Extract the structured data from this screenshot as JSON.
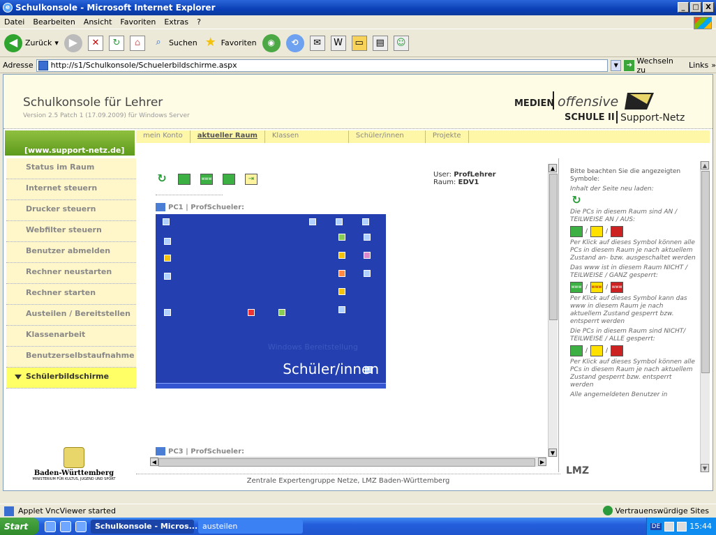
{
  "window": {
    "title": "Schulkonsole - Microsoft Internet Explorer",
    "min": "_",
    "max": "□",
    "close": "X"
  },
  "menu": [
    "Datei",
    "Bearbeiten",
    "Ansicht",
    "Favoriten",
    "Extras",
    "?"
  ],
  "toolbar": {
    "back": "Zurück",
    "search": "Suchen",
    "favorites": "Favoriten"
  },
  "address": {
    "label": "Adresse",
    "url": "http://s1/Schulkonsole/Schuelerbildschirme.aspx",
    "go": "Wechseln zu",
    "links": "Links"
  },
  "header": {
    "title": "Schulkonsole für Lehrer",
    "version": "Version 2.5 Patch 1 (17.09.2009) für Windows Server",
    "logo1": "MEDIEN",
    "logo2": "offensive",
    "logo3": "SCHULE II",
    "logo4": "Support-Netz"
  },
  "brand": "[www.support-netz.de]",
  "tabs": [
    "mein Konto",
    "aktueller Raum",
    "Klassen",
    "Schüler/innen",
    "Projekte"
  ],
  "sidebar": [
    "Status im Raum",
    "Internet steuern",
    "Drucker steuern",
    "Webfilter steuern",
    "Benutzer abmelden",
    "Rechner neustarten",
    "Rechner starten",
    "Austeilen / Bereitstellen",
    "Klassenarbeit",
    "Benutzerselbstaufnahme",
    "Schülerbildschirme"
  ],
  "user": {
    "user_label": "User:",
    "user": "ProfLehrer",
    "room_label": "Raum:",
    "room": "EDV1"
  },
  "pcs": [
    {
      "label": "PC1 | ProfSchueler:"
    },
    {
      "label": "PC3 | ProfSchueler:"
    }
  ],
  "screen": {
    "watermark": "Schüler/innen",
    "watermark2": "Windows Bereitstellung"
  },
  "right": {
    "p1": "Bitte beachten Sie die angezeigten Symbole:",
    "p2": "Inhalt der Seite neu laden:",
    "p3": "Die PCs in diesem Raum sind AN / TEILWEISE AN / AUS:",
    "p4": "Per Klick auf dieses Symbol können alle PCs in diesem Raum je nach aktuellem Zustand an- bzw. ausgeschaltet werden",
    "p5": "Das www ist in diesem Raum NICHT / TEILWEISE / GANZ gesperrt:",
    "p6": "Per Klick auf dieses Symbol kann das www in diesem Raum je nach aktuellem Zustand gesperrt bzw. entsperrt werden",
    "p7": "Die PCs in diesem Raum sind NICHT/ TEILWEISE / ALLE gesperrt:",
    "p8": "Per Klick auf dieses Symbol können alle PCs in diesem Raum je nach aktuellem Zustand gesperrt bzw. entsperrt werden",
    "p9": "Alle angemeldeten Benutzer in",
    "sep": "/",
    "www": "www"
  },
  "footer": "Zentrale Expertengruppe Netze, LMZ Baden-Württemberg",
  "bw": {
    "name": "Baden-Württemberg",
    "sub": "MINISTERIUM FÜR KULTUS, JUGEND UND SPORT"
  },
  "lmz": "LMZ",
  "status": {
    "text": "Applet VncViewer started",
    "zone": "Vertrauenswürdige Sites"
  },
  "taskbar": {
    "start": "Start",
    "tasks": [
      "Schulkonsole - Micros...",
      "austeilen"
    ],
    "lang": "DE",
    "time": "15:44"
  }
}
